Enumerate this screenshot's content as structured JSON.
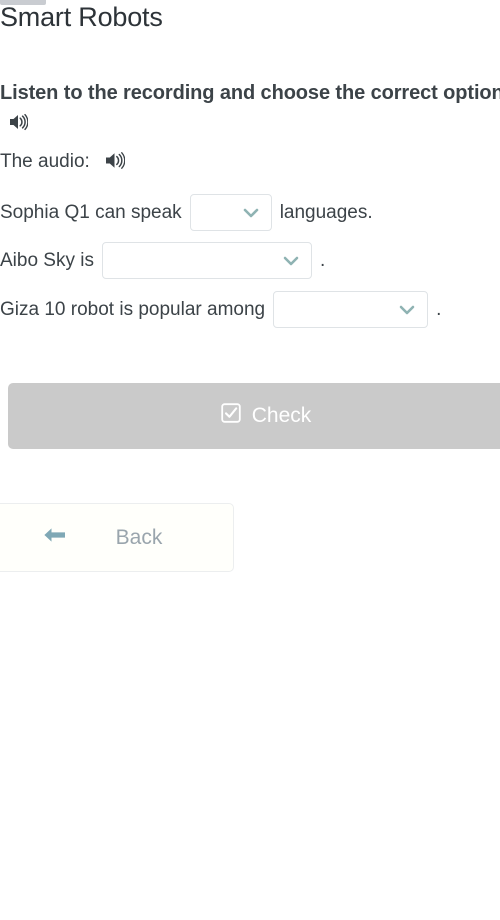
{
  "page": {
    "title": "Smart Robots",
    "prompt": "Listen to the recording and choose the correct option.",
    "audio_label": "The audio:",
    "icons": {
      "speaker": "speaker-icon",
      "checkbox": "checkbox-checked-icon",
      "chevron": "chevron-down-icon",
      "arrow_left": "arrow-left-icon"
    },
    "colors": {
      "text": "#3c4348",
      "title": "#2d3338",
      "chevron": "#8fb3b3",
      "check_button_bg": "#cacaca",
      "check_button_text": "#ffffff",
      "back_button_text": "#9aa5ad",
      "back_button_border": "#eceeef",
      "dropdown_border": "#dfe3e6"
    }
  },
  "questions": [
    {
      "before": "Sophia Q1 can speak",
      "value": "",
      "after": "languages.",
      "size": "small"
    },
    {
      "before": "Aibo Sky is",
      "value": "",
      "after": ".",
      "size": "large"
    },
    {
      "before": "Giza 10 robot is popular among",
      "value": "",
      "after": ".",
      "size": "med"
    }
  ],
  "actions": {
    "check_label": "Check",
    "back_label": "Back"
  }
}
